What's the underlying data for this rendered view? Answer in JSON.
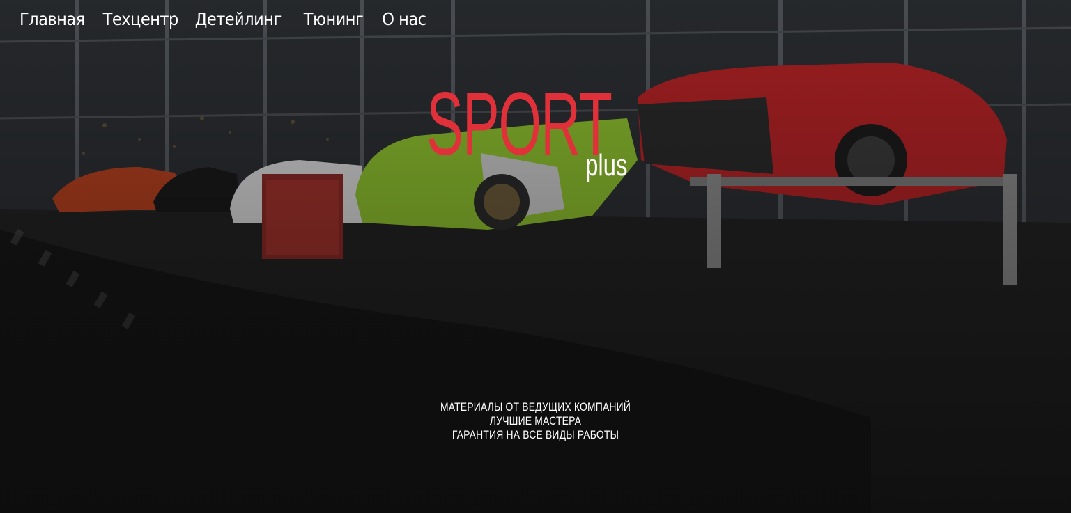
{
  "nav": {
    "items": [
      {
        "label": "Главная"
      },
      {
        "label": "Техцентр"
      },
      {
        "label": "Детейлинг"
      },
      {
        "label": "Тюнинг"
      },
      {
        "label": "О нас"
      }
    ]
  },
  "logo": {
    "main": "SPORT",
    "sub": "plus"
  },
  "taglines": [
    "МАТЕРИАЛЫ ОТ ВЕДУЩИХ КОМПАНИЙ",
    "ЛУЧШИЕ МАСТЕРА",
    "ГАРАНТИЯ НА ВСЕ ВИДЫ РАБОТЫ"
  ],
  "colors": {
    "brand_red": "#e0313b",
    "text": "#ffffff",
    "background": "#1a1a1a"
  }
}
